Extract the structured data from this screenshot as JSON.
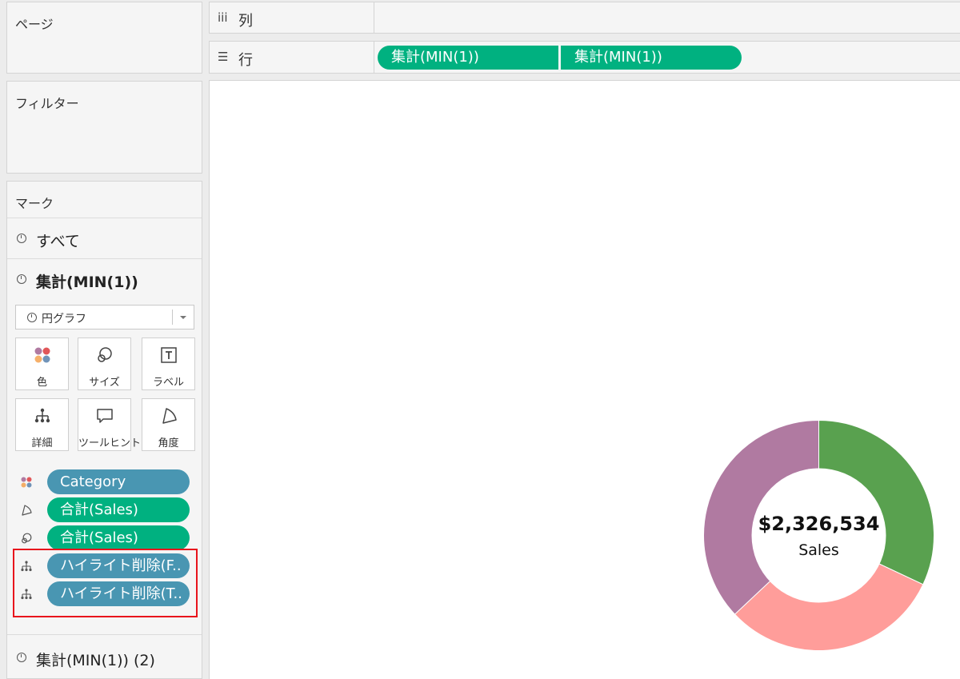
{
  "pages_panel": {
    "title": "ページ"
  },
  "filters_panel": {
    "title": "フィルター"
  },
  "marks_panel": {
    "title": "マーク",
    "all_label": "すべて",
    "layer1_label": "集計(MIN(1))",
    "mark_type": "円グラフ",
    "buttons": {
      "color": "色",
      "size": "サイズ",
      "label": "ラベル",
      "detail": "詳細",
      "tooltip": "ツールヒント",
      "angle": "角度"
    },
    "pills": [
      {
        "text": "Category",
        "icon": "color-dots-icon"
      },
      {
        "text": "合計(Sales)",
        "icon": "angle-icon"
      },
      {
        "text": "合計(Sales)",
        "icon": "size-icon"
      },
      {
        "text": "ハイライト削除(F..",
        "icon": "detail-icon"
      },
      {
        "text": "ハイライト削除(T..",
        "icon": "detail-icon"
      }
    ],
    "layer2_label": "集計(MIN(1)) (2)"
  },
  "columns_shelf": {
    "icon": "iii",
    "label": "列"
  },
  "rows_shelf": {
    "icon": "☰",
    "label": "行",
    "pills": [
      "集計(MIN(1))",
      "集計(MIN(1))"
    ]
  },
  "view": {
    "center_value": "$2,326,534",
    "center_label": "Sales"
  },
  "chart_data": {
    "type": "pie",
    "slices": [
      {
        "value": 0.32,
        "color": "#59a14f"
      },
      {
        "value": 0.31,
        "color": "#ff9d9a"
      },
      {
        "value": 0.37,
        "color": "#b07aa1"
      }
    ],
    "start_angle_deg": 0,
    "donut": true
  }
}
